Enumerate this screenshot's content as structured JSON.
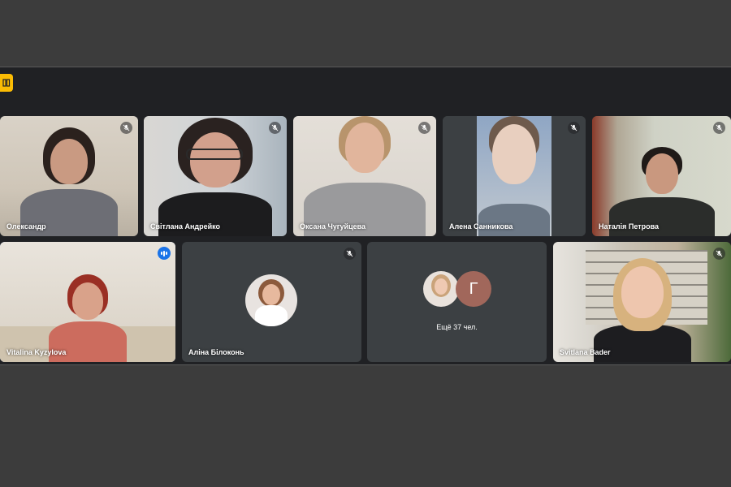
{
  "meeting": {
    "participants": [
      {
        "name": "Олександр",
        "muted": true
      },
      {
        "name": "Світлана Андрейко",
        "muted": true
      },
      {
        "name": "Оксана Чугуйцева",
        "muted": true
      },
      {
        "name": "Алена Санникова",
        "muted": true
      },
      {
        "name": "Наталія Петрова",
        "muted": true
      },
      {
        "name": "Vitalina Kyzylova",
        "muted": false,
        "speaking": true
      },
      {
        "name": "Аліна Білоконь",
        "muted": true
      },
      {
        "name": "Svitlana Bader",
        "muted": true
      }
    ],
    "more": {
      "avatar_letter": "Г",
      "label": "Ещё 37 чел."
    }
  },
  "colors": {
    "background": "#3c3c3c",
    "grid_background": "#202124",
    "tile": "#3c4043",
    "speaking_accent": "#1a73e8",
    "app_badge": "#fbbc04"
  },
  "icons": [
    "app-badge-icon",
    "mic-off-icon",
    "speaking-indicator-icon"
  ]
}
